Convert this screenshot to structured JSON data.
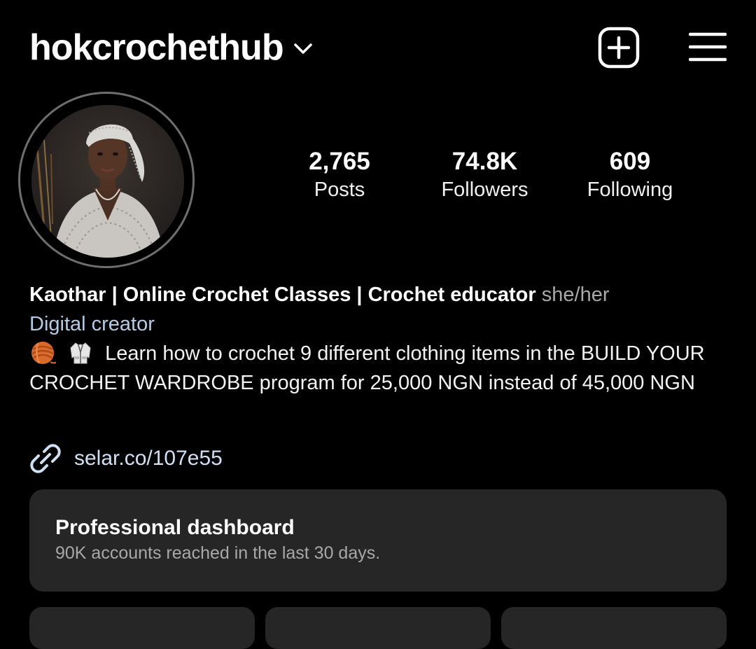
{
  "header": {
    "username": "hokcrochethub"
  },
  "stats": [
    {
      "value": "2,765",
      "label": "Posts"
    },
    {
      "value": "74.8K",
      "label": "Followers"
    },
    {
      "value": "609",
      "label": "Following"
    }
  ],
  "bio": {
    "name": "Kaothar | Online Crochet Classes | Crochet educator",
    "pronouns": "she/her",
    "category": "Digital creator",
    "text": "Learn how to crochet 9 different clothing items in the BUILD YOUR CROCHET WARDROBE program for 25,000 NGN instead of 45,000 NGN",
    "emojis": [
      "yarn-ball-icon",
      "coat-icon"
    ]
  },
  "link": {
    "text": "selar.co/107e55"
  },
  "dashboard": {
    "title": "Professional dashboard",
    "subtitle": "90K accounts reached in the last 30 days."
  },
  "colors": {
    "background": "#000000",
    "link": "#cfe0f5",
    "category": "#b4cbe6",
    "card": "#262626",
    "muted": "#a8a8a8"
  }
}
